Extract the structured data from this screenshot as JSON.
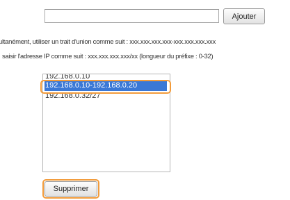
{
  "address_input": {
    "value": "",
    "add_button_label": "Ajouter"
  },
  "hints": {
    "range_hint": "ultanément, utiliser un trait d'union comme suit : xxx.xxx.xxx.xxx-xxx.xxx.xxx.xxx",
    "prefix_hint": "saisir l'adresse IP comme suit : xxx.xxx.xxx.xxx/xx (longueur du préfixe : 0-32)"
  },
  "address_list": {
    "items": [
      "192.168.0.10",
      "192.168.0.10-192.168.0.20",
      "192.168.0.32/27"
    ],
    "selected_index": 1,
    "highlight_color": "#f29b3a",
    "selection_color": "#3a78d6"
  },
  "delete_button_label": "Supprimer"
}
